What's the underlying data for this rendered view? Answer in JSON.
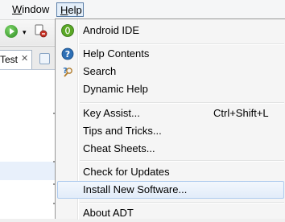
{
  "menubar": {
    "window_label": "Window",
    "help_label": "Help"
  },
  "editor": {
    "tab_label": "Test",
    "tab_close": "✕"
  },
  "toolbar": {
    "run_icon": "run-icon",
    "debug_icon": "debug-icon",
    "dropdown_glyph": "▾"
  },
  "help_menu": {
    "items": [
      {
        "label": "Android IDE",
        "icon": "android-ide-icon",
        "shortcut": ""
      },
      {
        "label": "Help Contents",
        "icon": "help-contents-icon",
        "shortcut": ""
      },
      {
        "label": "Search",
        "icon": "search-help-icon",
        "shortcut": ""
      },
      {
        "label": "Dynamic Help",
        "icon": "",
        "shortcut": ""
      },
      {
        "label": "Key Assist...",
        "icon": "",
        "shortcut": "Ctrl+Shift+L"
      },
      {
        "label": "Tips and Tricks...",
        "icon": "",
        "shortcut": ""
      },
      {
        "label": "Cheat Sheets...",
        "icon": "",
        "shortcut": ""
      },
      {
        "label": "Check for Updates",
        "icon": "",
        "shortcut": ""
      },
      {
        "label": "Install New Software...",
        "icon": "",
        "shortcut": "",
        "highlighted": true
      },
      {
        "label": "About ADT",
        "icon": "",
        "shortcut": ""
      }
    ]
  },
  "colors": {
    "highlight_border": "#aecbee",
    "android_icon": "#5aa825"
  }
}
